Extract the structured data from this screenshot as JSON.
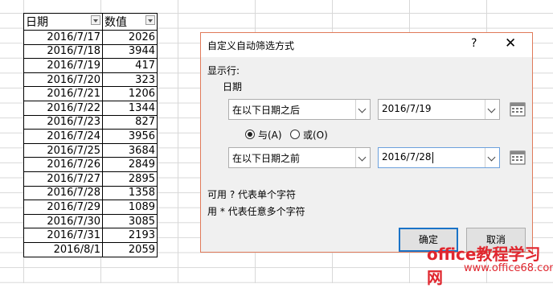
{
  "sheet": {
    "header": [
      "日期",
      "数值"
    ],
    "rows": [
      [
        "2016/7/17",
        "2026"
      ],
      [
        "2016/7/18",
        "3944"
      ],
      [
        "2016/7/19",
        "417"
      ],
      [
        "2016/7/20",
        "323"
      ],
      [
        "2016/7/21",
        "1206"
      ],
      [
        "2016/7/22",
        "1344"
      ],
      [
        "2016/7/23",
        "827"
      ],
      [
        "2016/7/24",
        "3956"
      ],
      [
        "2016/7/25",
        "3684"
      ],
      [
        "2016/7/26",
        "2849"
      ],
      [
        "2016/7/27",
        "2895"
      ],
      [
        "2016/7/28",
        "1358"
      ],
      [
        "2016/7/29",
        "1089"
      ],
      [
        "2016/7/30",
        "3085"
      ],
      [
        "2016/7/31",
        "2193"
      ],
      [
        "2016/8/1",
        "2059"
      ]
    ]
  },
  "dialog": {
    "title": "自定义自动筛选方式",
    "help": "?",
    "close": "✕",
    "show_rows_label": "显示行:",
    "field_label": "日期",
    "cond1_op": "在以下日期之后",
    "cond1_val": "2016/7/19",
    "and_label": "与(A)",
    "or_label": "或(O)",
    "logic_selected": "and",
    "cond2_op": "在以下日期之前",
    "cond2_val": "2016/7/28",
    "hint1": "可用 ? 代表单个字符",
    "hint2": "用 * 代表任意多个字符",
    "ok": "确定",
    "cancel": "取消"
  },
  "watermark": {
    "line1": "office教程学习网",
    "line2": "www.office68.com"
  },
  "colors": {
    "dialog_border": "#e07a5a",
    "default_button": "#1a73c7",
    "watermark": "#e0262e"
  }
}
